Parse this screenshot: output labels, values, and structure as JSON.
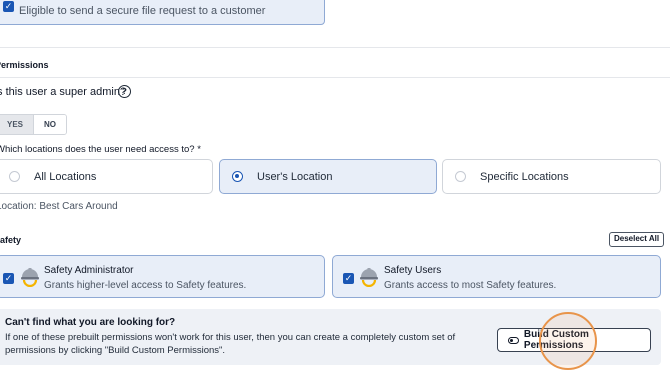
{
  "top_card": {
    "description": "Eligible to send a secure file request to a customer",
    "checked": true
  },
  "permissions": {
    "section_title": "Permissions",
    "super_admin_question": "Is this user a super admin?",
    "yes_label": "YES",
    "no_label": "NO",
    "selected": "YES"
  },
  "locations": {
    "question": "Which locations does the user need access to? *",
    "options": [
      {
        "label": "All Locations",
        "selected": false
      },
      {
        "label": "User's Location",
        "selected": true
      },
      {
        "label": "Specific Locations",
        "selected": false
      }
    ],
    "location_text": "Location: Best Cars Around"
  },
  "safety": {
    "section_title": "Safety",
    "deselect_all_label": "Deselect All",
    "cards": [
      {
        "title": "Safety Administrator",
        "description": "Grants higher-level access to Safety features.",
        "checked": true,
        "icon": "hard-hat-icon"
      },
      {
        "title": "Safety Users",
        "description": "Grants access to most Safety features.",
        "checked": true,
        "icon": "hard-hat-icon"
      }
    ]
  },
  "custom": {
    "title": "Can't find what you are looking for?",
    "body_line1": "If one of these prebuilt permissions won't work for this user, then you can create a completely custom set of",
    "body_line2": "permissions by clicking \"Build Custom Permissions\".",
    "button_label": "Build Custom Permissions",
    "button_icon": "toggle-icon"
  },
  "colors": {
    "accent": "#1a56b4",
    "selected_bg": "#e8eef8",
    "highlight_ring": "#e8944a"
  }
}
